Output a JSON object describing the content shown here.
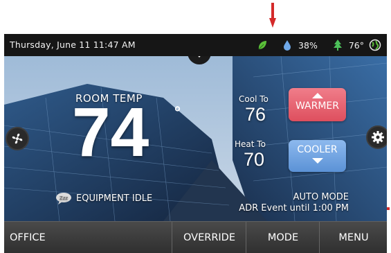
{
  "status_bar": {
    "datetime": "Thursday, June 11 11:47 AM",
    "humidity": "38%",
    "outdoor_temp": "76°"
  },
  "main": {
    "room_temp_label": "ROOM TEMP",
    "room_temp_value": "74",
    "degree_symbol": "°",
    "cool_to_label": "Cool To",
    "cool_to_value": "76",
    "heat_to_label": "Heat To",
    "heat_to_value": "70",
    "warmer_label": "WARMER",
    "cooler_label": "COOLER",
    "equipment_status": "EQUIPMENT IDLE",
    "fan_icon_text": "Zzz",
    "mode_text": "AUTO MODE",
    "adr_event_text": "ADR Event until 1:00 PM"
  },
  "nav": {
    "office": "OFFICE",
    "override": "OVERRIDE",
    "mode": "MODE",
    "menu": "MENU"
  },
  "colors": {
    "annotation_red": "#d42a2a",
    "warmer": "#e55a67",
    "cooler": "#6fa3e0",
    "leaf_green": "#5cbf3a"
  },
  "icons": [
    "leaf-icon",
    "water-drop-icon",
    "tree-icon",
    "globe-icon",
    "fan-icon",
    "gear-icon",
    "sleep-bubble-icon"
  ]
}
